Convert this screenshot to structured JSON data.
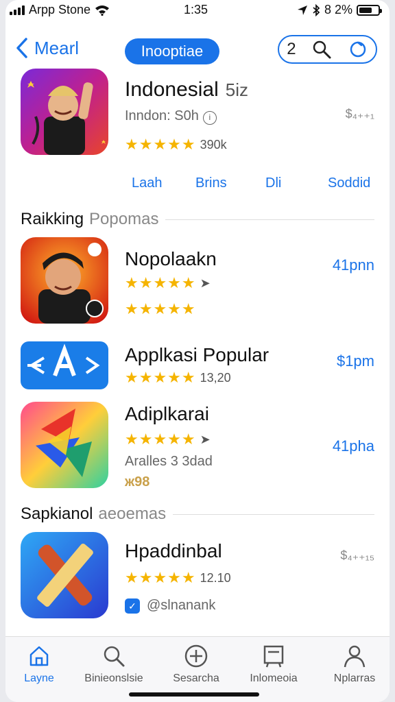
{
  "status_bar": {
    "carrier": "Arpp Stone",
    "time": "1:35",
    "battery": "8 2%"
  },
  "nav": {
    "back_label": "Mearl",
    "segment_label": "Inooptiae",
    "tool_number": "2"
  },
  "featured": {
    "title": "Indonesial",
    "title_suffix": "5iz",
    "subtitle": "Inndon: S0h",
    "info_glyph": "i",
    "price": "$₄₊₊₁",
    "rating_count": "390k"
  },
  "actions": [
    "Laah",
    "Brins",
    "Dli",
    "Soddid"
  ],
  "section1": {
    "title": "Raikking",
    "subtitle": "Popomas"
  },
  "section2": {
    "title": "Sapkianol",
    "subtitle": "aeoemas"
  },
  "apps": [
    {
      "name": "Nopolaakn",
      "price": "41pnn",
      "rating_text": ""
    },
    {
      "name": "Applkasi Popular",
      "price": "$1pm",
      "rating_text": "13,20"
    },
    {
      "name": "Adiplkarai",
      "price": "41pha",
      "rating_text": "",
      "meta": "Aralles 3 3dad",
      "extra": "ж98"
    },
    {
      "name": "Hpaddinbal",
      "price": "$₄₊₊₁₅",
      "rating_text": "12.10",
      "meta": "@slnanank"
    }
  ],
  "tabs": [
    "Layne",
    "Binieonslsie",
    "Sesarcha",
    "Inlomeoia",
    "Nplarras"
  ],
  "colors": {
    "accent": "#1a73e8",
    "star": "#f5b400"
  }
}
